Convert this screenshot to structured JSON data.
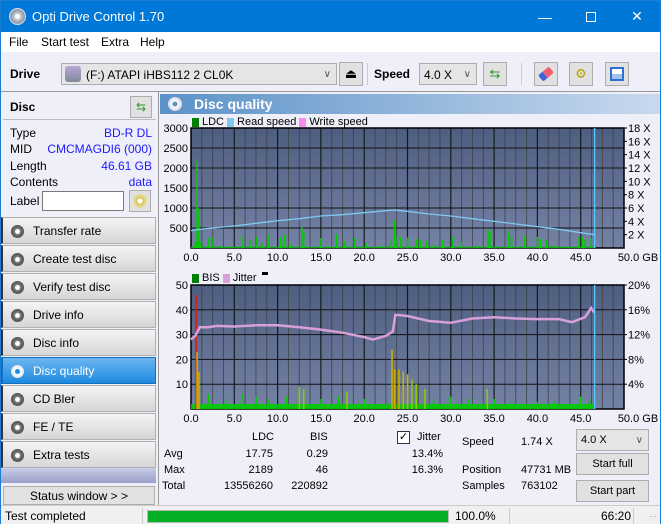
{
  "window": {
    "title": "Opti Drive Control 1.70",
    "minimize_icon": "minimize-icon",
    "maximize_icon": "maximize-icon",
    "close_icon": "close-icon"
  },
  "menu": [
    "File",
    "Start test",
    "Extra",
    "Help"
  ],
  "toolbar": {
    "drive_label": "Drive",
    "drive_value": "(F:)  ATAPI iHBS112  2 CL0K",
    "speed_label": "Speed",
    "speed_value": "4.0 X",
    "icons": [
      "eject-icon",
      "refresh-icon",
      "eraser-icon",
      "settings-icon",
      "save-icon"
    ]
  },
  "disc": {
    "header": "Disc",
    "rows": [
      {
        "key": "Type",
        "value": "BD-R DL"
      },
      {
        "key": "MID",
        "value": "CMCMAGDI6 (000)"
      },
      {
        "key": "Length",
        "value": "46.61 GB"
      },
      {
        "key": "Contents",
        "value": "data"
      }
    ],
    "label_key": "Label",
    "label_value": ""
  },
  "nav": [
    {
      "label": "Transfer rate",
      "active": false
    },
    {
      "label": "Create test disc",
      "active": false
    },
    {
      "label": "Verify test disc",
      "active": false
    },
    {
      "label": "Drive info",
      "active": false
    },
    {
      "label": "Disc info",
      "active": false
    },
    {
      "label": "Disc quality",
      "active": true
    },
    {
      "label": "CD Bler",
      "active": false
    },
    {
      "label": "FE / TE",
      "active": false
    },
    {
      "label": "Extra tests",
      "active": false
    }
  ],
  "status_window_button": "Status window > >",
  "panel": {
    "title": "Disc quality"
  },
  "colors": {
    "plot_bg_top": "#4e5e80",
    "plot_bg_bottom": "#7482a6",
    "ldc": "#00cc00",
    "read_speed": "#7fc8f0",
    "write_speed": "#ff88ee",
    "bis": "#00cc00",
    "jitter": "#d8a0d8",
    "end_marker": "#50c8ff"
  },
  "chart_data": [
    {
      "type": "bar",
      "title": "LDC / Read speed",
      "legend": [
        "LDC",
        "Read speed",
        "Write speed"
      ],
      "legend_placement": "top-left",
      "xlabel": "GB",
      "x_ticks": [
        "0.0",
        "5.0",
        "10.0",
        "15.0",
        "20.0",
        "25.0",
        "30.0",
        "35.0",
        "40.0",
        "45.0",
        "50.0 GB"
      ],
      "xlim": [
        0,
        50
      ],
      "y_left_ticks": [
        "500",
        "1000",
        "1500",
        "2000",
        "2500",
        "3000"
      ],
      "ylim_left": [
        0,
        3000
      ],
      "y_right_ticks": [
        "2 X",
        "4 X",
        "6 X",
        "8 X",
        "10 X",
        "12 X",
        "14 X",
        "16 X",
        "18 X"
      ],
      "ylim_right": [
        0,
        18
      ],
      "grid": true,
      "end_position_gb": 46.61,
      "series": [
        {
          "name": "LDC",
          "points": [
            [
              0.3,
              60
            ],
            [
              0.5,
              150
            ],
            [
              0.7,
              2189
            ],
            [
              0.8,
              1000
            ],
            [
              0.9,
              700
            ],
            [
              1.1,
              150
            ],
            [
              2.0,
              250
            ],
            [
              2.4,
              300
            ],
            [
              3.5,
              50
            ],
            [
              4.5,
              40
            ],
            [
              6.0,
              300
            ],
            [
              6.8,
              200
            ],
            [
              7.6,
              280
            ],
            [
              8.2,
              120
            ],
            [
              9.0,
              350
            ],
            [
              10.3,
              250
            ],
            [
              10.8,
              330
            ],
            [
              11.5,
              100
            ],
            [
              12.8,
              520
            ],
            [
              13.0,
              400
            ],
            [
              15.0,
              250
            ],
            [
              16.8,
              350
            ],
            [
              17.7,
              180
            ],
            [
              18.9,
              270
            ],
            [
              20.2,
              130
            ],
            [
              22.0,
              60
            ],
            [
              23.1,
              180
            ],
            [
              23.5,
              700
            ],
            [
              23.8,
              300
            ],
            [
              24.2,
              280
            ],
            [
              25.0,
              260
            ],
            [
              26.0,
              220
            ],
            [
              26.5,
              200
            ],
            [
              27.2,
              180
            ],
            [
              28.0,
              100
            ],
            [
              29.0,
              200
            ],
            [
              30.2,
              280
            ],
            [
              31.2,
              150
            ],
            [
              33.0,
              60
            ],
            [
              34.3,
              450
            ],
            [
              34.5,
              420
            ],
            [
              36.7,
              420
            ],
            [
              37.0,
              300
            ],
            [
              38.5,
              300
            ],
            [
              40.0,
              280
            ],
            [
              40.3,
              230
            ],
            [
              41.0,
              200
            ],
            [
              42.0,
              60
            ],
            [
              43.5,
              50
            ],
            [
              44.8,
              280
            ],
            [
              45.2,
              280
            ],
            [
              45.5,
              200
            ],
            [
              46.2,
              250
            ],
            [
              46.5,
              60
            ]
          ]
        },
        {
          "name": "Read speed",
          "unit": "X",
          "points": [
            [
              0,
              2.6
            ],
            [
              1,
              2.8
            ],
            [
              2.5,
              3.0
            ],
            [
              5,
              3.3
            ],
            [
              7.5,
              3.7
            ],
            [
              10,
              4.1
            ],
            [
              12.5,
              4.4
            ],
            [
              15,
              4.8
            ],
            [
              17.5,
              5.0
            ],
            [
              20,
              5.3
            ],
            [
              22.5,
              5.6
            ],
            [
              23.5,
              5.7
            ],
            [
              25,
              5.5
            ],
            [
              27.5,
              5.1
            ],
            [
              30,
              4.8
            ],
            [
              32.5,
              4.4
            ],
            [
              35,
              4.0
            ],
            [
              37.5,
              3.6
            ],
            [
              40,
              3.2
            ],
            [
              42.5,
              2.8
            ],
            [
              45,
              2.3
            ],
            [
              46.6,
              2.0
            ]
          ]
        },
        {
          "name": "Write speed",
          "points": []
        }
      ]
    },
    {
      "type": "bar",
      "title": "BIS / Jitter",
      "legend": [
        "BIS",
        "Jitter"
      ],
      "legend_placement": "top-left",
      "xlabel": "GB",
      "x_ticks": [
        "0.0",
        "5.0",
        "10.0",
        "15.0",
        "20.0",
        "25.0",
        "30.0",
        "35.0",
        "40.0",
        "45.0",
        "50.0 GB"
      ],
      "xlim": [
        0,
        50
      ],
      "y_left_ticks": [
        "10",
        "20",
        "30",
        "40",
        "50"
      ],
      "ylim_left": [
        0,
        50
      ],
      "y_right_ticks": [
        "4%",
        "8%",
        "12%",
        "16%",
        "20%"
      ],
      "ylim_right": [
        0,
        20
      ],
      "grid": true,
      "end_position_gb": 46.61,
      "series": [
        {
          "name": "BIS",
          "points": [
            [
              0.6,
              46
            ],
            [
              0.7,
              23
            ],
            [
              0.9,
              15
            ],
            [
              2.0,
              6
            ],
            [
              4.0,
              4
            ],
            [
              6.0,
              6
            ],
            [
              7.5,
              5
            ],
            [
              9.0,
              4
            ],
            [
              11.0,
              5
            ],
            [
              12.5,
              9
            ],
            [
              13.0,
              8
            ],
            [
              15.0,
              4
            ],
            [
              17.0,
              5
            ],
            [
              18.0,
              7
            ],
            [
              20.0,
              4
            ],
            [
              23.2,
              24
            ],
            [
              23.5,
              16
            ],
            [
              24.0,
              16
            ],
            [
              24.5,
              15
            ],
            [
              25.0,
              14
            ],
            [
              25.5,
              12
            ],
            [
              26.0,
              10
            ],
            [
              27.0,
              8
            ],
            [
              28.0,
              4
            ],
            [
              30.0,
              5
            ],
            [
              32.0,
              4
            ],
            [
              34.2,
              8
            ],
            [
              35.0,
              4
            ],
            [
              37.0,
              3
            ],
            [
              40.0,
              3
            ],
            [
              42.0,
              3
            ],
            [
              45.0,
              5
            ],
            [
              46.0,
              4
            ],
            [
              46.6,
              3
            ]
          ]
        },
        {
          "name": "Jitter",
          "unit": "%",
          "points": [
            [
              0,
              11.2
            ],
            [
              0.5,
              11.8
            ],
            [
              1.0,
              13.2
            ],
            [
              2.0,
              13.2
            ],
            [
              3.0,
              13.4
            ],
            [
              5.0,
              13.3
            ],
            [
              7.5,
              13.5
            ],
            [
              10.0,
              13.5
            ],
            [
              12.5,
              13.2
            ],
            [
              15.0,
              12.8
            ],
            [
              17.5,
              12.3
            ],
            [
              20.0,
              11.6
            ],
            [
              21.0,
              11.2
            ],
            [
              22.5,
              11.8
            ],
            [
              23.3,
              12.5
            ],
            [
              23.6,
              15.2
            ],
            [
              25.0,
              15.0
            ],
            [
              27.5,
              14.2
            ],
            [
              30.0,
              13.9
            ],
            [
              32.5,
              14.6
            ],
            [
              35.0,
              14.8
            ],
            [
              37.5,
              14.6
            ],
            [
              40.0,
              14.5
            ],
            [
              42.5,
              14.5
            ],
            [
              44.0,
              14.0
            ],
            [
              45.5,
              14.8
            ],
            [
              46.2,
              16.3
            ],
            [
              46.6,
              15.5
            ]
          ]
        }
      ]
    }
  ],
  "results": {
    "col_ldc": "LDC",
    "col_bis": "BIS",
    "jitter_label": "Jitter",
    "jitter_checked": true,
    "rows": [
      {
        "label": "Avg",
        "ldc": "17.75",
        "bis": "0.29",
        "jitter": "13.4%"
      },
      {
        "label": "Max",
        "ldc": "2189",
        "bis": "46",
        "jitter": "16.3%"
      },
      {
        "label": "Total",
        "ldc": "13556260",
        "bis": "220892",
        "jitter": ""
      }
    ],
    "speed_label": "Speed",
    "speed_value": "1.74 X",
    "position_label": "Position",
    "position_value": "47731 MB",
    "samples_label": "Samples",
    "samples_value": "763102",
    "speed_select": "4.0 X",
    "start_full": "Start full",
    "start_part": "Start part"
  },
  "statusbar": {
    "status": "Test completed",
    "progress_percent": 100,
    "progress_text": "100.0%",
    "elapsed": "66:20"
  }
}
